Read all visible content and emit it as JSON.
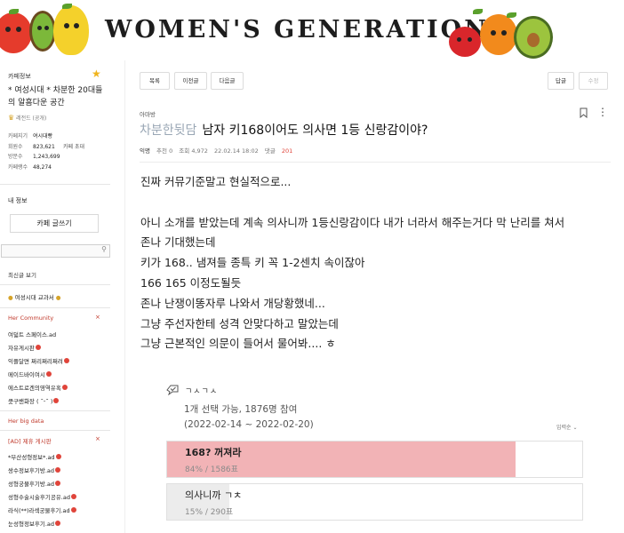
{
  "banner": {
    "title": "WOMEN'S GENERATION"
  },
  "sidebar": {
    "cafe_info_label": "카페정보",
    "cafe_name": "* 여성시대 * 차분한 20대들의 알흠다운 공간",
    "level": "레전드 (공개)",
    "stats": [
      {
        "key": "카페지기",
        "value": "여시대빵",
        "key2": "",
        "value2": ""
      },
      {
        "key": "회원수",
        "value": "823,621",
        "key2": "카페 초대",
        "value2": ""
      },
      {
        "key": "방문수",
        "value": "1,243,699",
        "key2": "",
        "value2": ""
      },
      {
        "key": "카페랭수",
        "value": "48,274",
        "key2": "",
        "value2": ""
      }
    ],
    "my_info": "내 정보",
    "write_button": "카페 글쓰기",
    "recent": "최신글 보기",
    "textbook": "여성시대 교과서",
    "section_community": "Her Community",
    "community_items": [
      "여덟트 스페이스.ad",
      "자유게시판",
      "익플달면 쩌리쩌리쩌려",
      "메이드바이여시",
      "에스트로겐의영역유혹",
      "쿳구밴화장 ( ˘ᵕ˘ )"
    ],
    "section_bigdata": "Her big data",
    "section_ad": "[AD] 제휴 게시판",
    "ad_items": [
      "*부산성형정보*.ad",
      "쌍수정보후기방.ad",
      "성형궁물후기방.ad",
      "성형수술시술후기공유.ad",
      "라식(**)라섹궁물후기.ad",
      "눈성형정보후기.ad"
    ]
  },
  "post": {
    "buttons": {
      "list": "목록",
      "prev": "이전글",
      "next": "다음글",
      "reply": "답글",
      "edit": "수정"
    },
    "category": "아마방",
    "title_prefix": "차분한뒷담",
    "title": "남자 키168이어도 의사면 1등 신랑감이야?",
    "author": "익명",
    "likes": "추천 0",
    "views": "조회 4,972",
    "date": "22.02.14 18:02",
    "comments_label": "댓글",
    "comments_count": "201",
    "body": [
      "진짜 커뮤기준말고 현실적으로...",
      "",
      "아니 소개를 받았는데 계속 의사니까 1등신랑감이다 내가 너라서 해주는거다 막 난리를 쳐서",
      "존나 기대했는데",
      "키가 168.. 냄져들 종특 키 꼭 1-2센치 속이잖아",
      "166 165 이정도될듯",
      "존나 난쟁이똥자루 나와서 개당황했네...",
      "그냥 주선자한테 성격 안맞다하고 말았는데",
      "그냥 근본적인 의문이 들어서 물어봐.... ㅎ"
    ]
  },
  "poll": {
    "title": "ㄱㅅㄱㅅ",
    "info": "1개 선택 가능, 1876명 참여",
    "period": "(2022-02-14 ~ 2022-02-20)",
    "sort": "입력순",
    "options": [
      {
        "label": "168? 꺼져라",
        "stat": "84% / 1586표",
        "percent": 84
      },
      {
        "label": "의사니까 ㄱㅊ",
        "stat": "15% / 290표",
        "percent": 15
      }
    ],
    "colors": {
      "winner_fill": "#f2b3b6",
      "other_fill": "#ececec"
    }
  }
}
